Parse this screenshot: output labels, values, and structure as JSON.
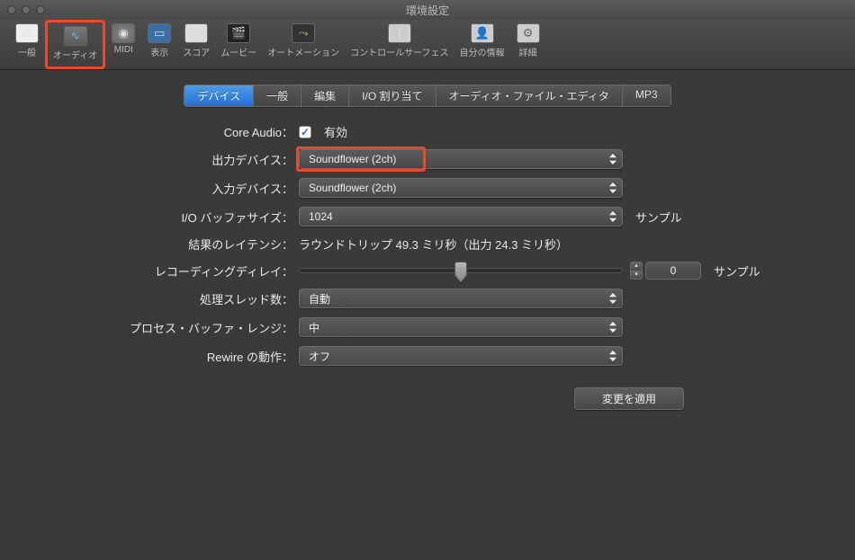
{
  "window": {
    "title": "環境設定"
  },
  "toolbar": {
    "items": [
      {
        "label": "一般"
      },
      {
        "label": "オーディオ"
      },
      {
        "label": "MIDI"
      },
      {
        "label": "表示"
      },
      {
        "label": "スコア"
      },
      {
        "label": "ムービー"
      },
      {
        "label": "オートメーション"
      },
      {
        "label": "コントロールサーフェス"
      },
      {
        "label": "自分の情報"
      },
      {
        "label": "詳細"
      }
    ]
  },
  "tabs": {
    "items": [
      "デバイス",
      "一般",
      "編集",
      "I/O 割り当て",
      "オーディオ・ファイル・エディタ",
      "MP3"
    ],
    "active": 0
  },
  "form": {
    "core_audio_label": "Core Audio：",
    "core_audio_value": "有効",
    "output_label": "出力デバイス：",
    "output_value": "Soundflower (2ch)",
    "input_label": "入力デバイス：",
    "input_value": "Soundflower (2ch)",
    "buffer_label": "I/O バッファサイズ：",
    "buffer_value": "1024",
    "sample_suffix": "サンプル",
    "latency_label": "結果のレイテンシ：",
    "latency_value": "ラウンドトリップ 49.3 ミリ秒（出力 24.3 ミリ秒）",
    "delay_label": "レコーディングディレイ：",
    "delay_value": "0",
    "threads_label": "処理スレッド数：",
    "threads_value": "自動",
    "procbuf_label": "プロセス・バッファ・レンジ：",
    "procbuf_value": "中",
    "rewire_label": "Rewire の動作：",
    "rewire_value": "オフ",
    "apply_button": "変更を適用"
  }
}
